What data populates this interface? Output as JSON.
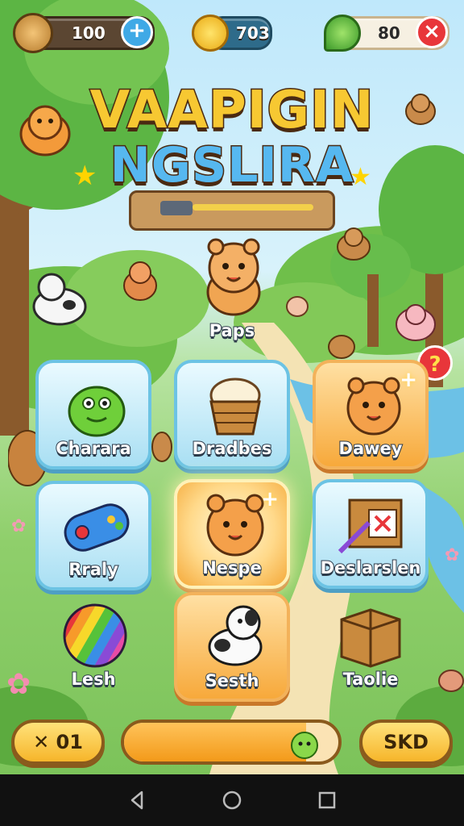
{
  "currencies": {
    "wood": {
      "amount": "100",
      "icon": "bread-coin-icon",
      "action_icon": "plus-icon"
    },
    "gold": {
      "amount": "703",
      "icon": "gold-coin-icon"
    },
    "gem": {
      "amount": "80",
      "icon": "green-gem-icon",
      "action_icon": "close-icon"
    }
  },
  "title": {
    "line1": "VAAPIGIN",
    "line2": "NGSLIRA"
  },
  "featured": {
    "label": "Paps"
  },
  "notification_badge": "?",
  "tiles": [
    {
      "label": "Charara",
      "icon": "green-monster-icon",
      "style": "blue"
    },
    {
      "label": "Dradbes",
      "icon": "cream-basket-icon",
      "style": "blue"
    },
    {
      "label": "Dawey",
      "icon": "hamster-icon",
      "style": "orange"
    },
    {
      "label": "Rraly",
      "icon": "gamepad-icon",
      "style": "blue"
    },
    {
      "label": "Nespe",
      "icon": "hamster-icon",
      "style": "glow"
    },
    {
      "label": "Deslarslen",
      "icon": "crate-icon",
      "style": "blue"
    },
    {
      "label": "Lesh",
      "icon": "rainbow-ball-icon",
      "style": "none"
    },
    {
      "label": "Sesth",
      "icon": "puppy-icon",
      "style": "orange"
    },
    {
      "label": "Taolie",
      "icon": "chest-icon",
      "style": "none"
    }
  ],
  "bottom_bar": {
    "left_button": "✕ 01",
    "progress_fraction": 0.85,
    "right_button": "SKD"
  },
  "system_nav": [
    "back-icon",
    "home-icon",
    "recents-icon"
  ],
  "colors": {
    "accent_orange": "#f6a53a",
    "accent_blue": "#8fd5ee",
    "brown": "#5b4632"
  }
}
